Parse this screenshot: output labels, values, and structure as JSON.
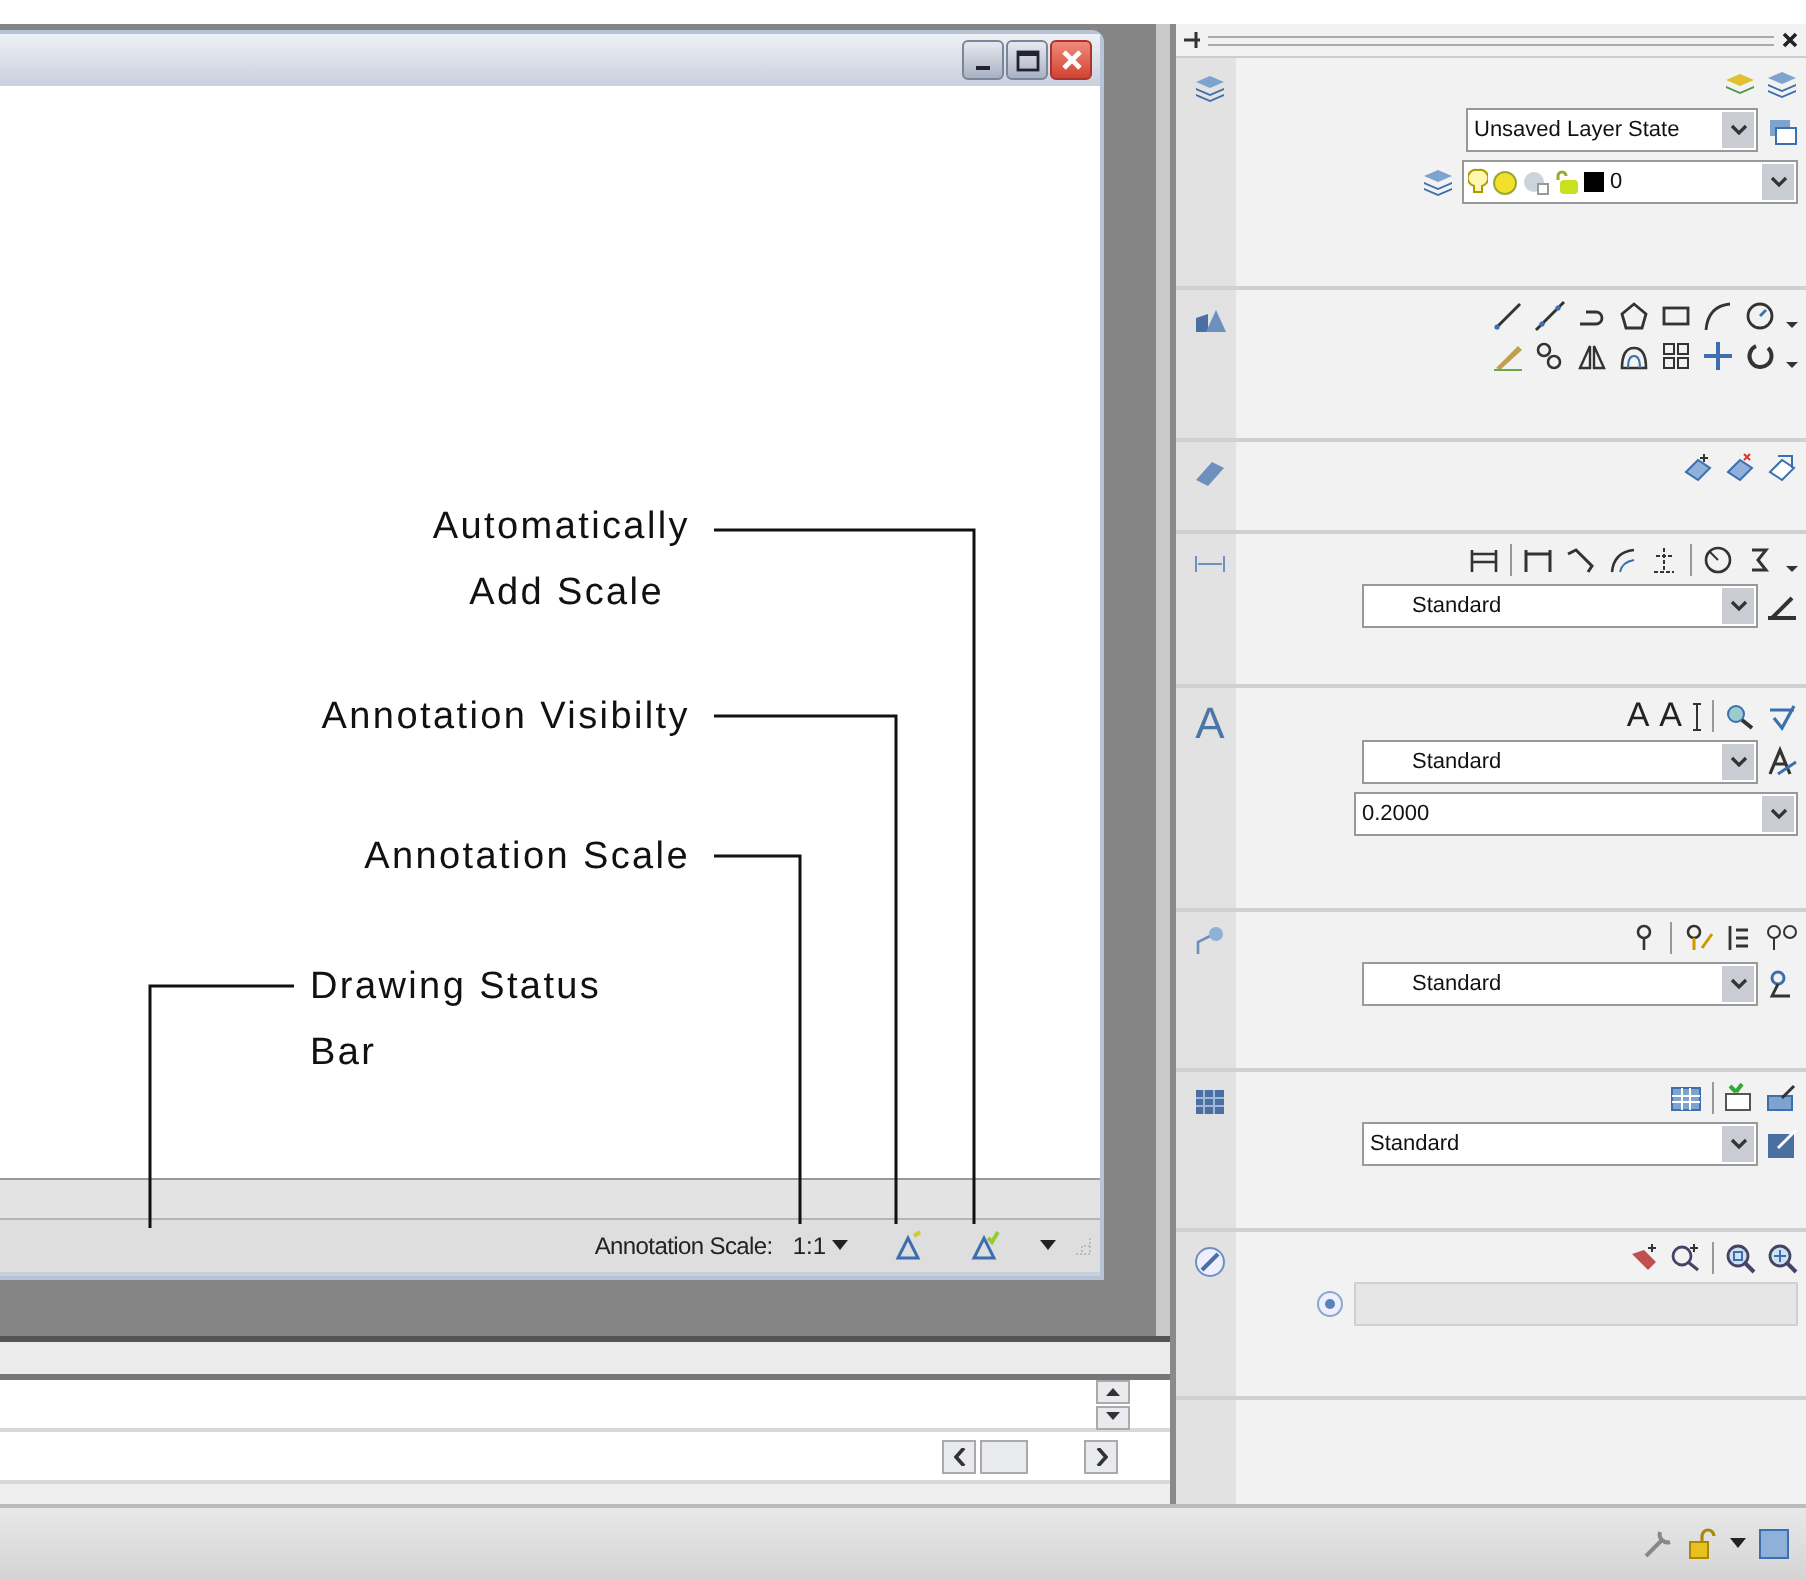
{
  "callouts": [
    {
      "kind": "auto_add_scale",
      "lines": [
        "Automatically",
        "Add Scale"
      ]
    },
    {
      "kind": "annotation_visibility",
      "lines": [
        "Annotation Visibilty"
      ]
    },
    {
      "kind": "annotation_scale",
      "lines": [
        "Annotation Scale"
      ]
    },
    {
      "kind": "drawing_status_bar",
      "lines": [
        "Drawing Status",
        "Bar"
      ]
    }
  ],
  "status_bar": {
    "label": "Annotation Scale:",
    "value": "1:1"
  },
  "dashboard": {
    "sections": [
      {
        "kind": "layers",
        "dropdowns": [
          {
            "value": "Unsaved Layer State",
            "disabled": false
          },
          {
            "value": "0",
            "disabled": false
          }
        ]
      },
      {
        "kind": "draw"
      },
      {
        "kind": "objects"
      },
      {
        "kind": "dimensions",
        "dropdowns": [
          {
            "value": "Standard",
            "disabled": false
          }
        ]
      },
      {
        "kind": "text",
        "glyph": "A",
        "tool_glyphs": [
          "A",
          "A"
        ],
        "dropdowns": [
          {
            "value": "Standard",
            "disabled": false
          },
          {
            "value": "0.2000",
            "disabled": false
          }
        ]
      },
      {
        "kind": "multileader",
        "dropdowns": [
          {
            "value": "Standard",
            "disabled": false
          }
        ]
      },
      {
        "kind": "tables",
        "dropdowns": [
          {
            "value": "Standard",
            "disabled": false
          }
        ]
      },
      {
        "kind": "navigation",
        "dropdowns": [
          {
            "disabled": true
          }
        ]
      }
    ]
  }
}
